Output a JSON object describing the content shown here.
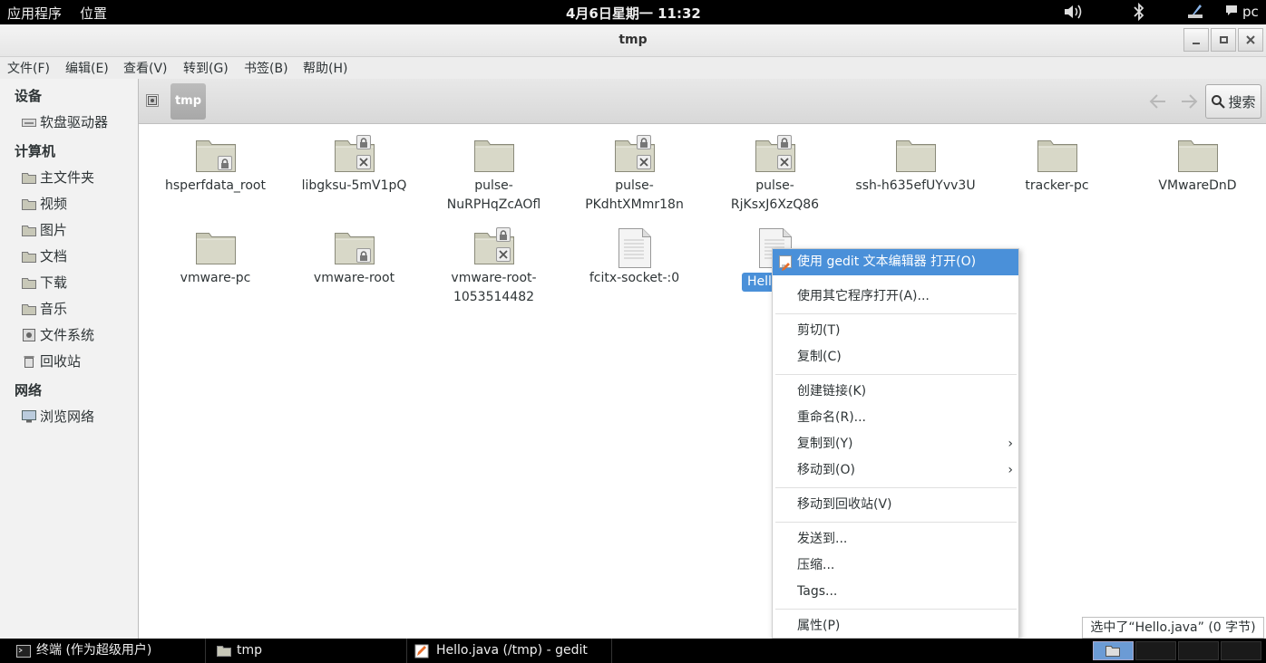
{
  "topbar": {
    "apps": "应用程序",
    "places": "位置",
    "clock": "4月6日星期一 11:32",
    "user": "pc"
  },
  "window": {
    "title": "tmp"
  },
  "menubar": [
    "文件(F)",
    "编辑(E)",
    "查看(V)",
    "转到(G)",
    "书签(B)",
    "帮助(H)"
  ],
  "sidebar": {
    "devices_header": "设备",
    "floppy": "软盘驱动器",
    "computer_header": "计算机",
    "home": "主文件夹",
    "videos": "视频",
    "pictures": "图片",
    "documents": "文档",
    "downloads": "下载",
    "music": "音乐",
    "filesystem": "文件系统",
    "trash": "回收站",
    "network_header": "网络",
    "browse_network": "浏览网络"
  },
  "toolbar": {
    "path": "tmp",
    "search": "搜索"
  },
  "files": [
    {
      "line1": "hsperfdata_root",
      "line2": ""
    },
    {
      "line1": "libgksu-5mV1pQ",
      "line2": ""
    },
    {
      "line1": "pulse-",
      "line2": "NuRPHqZcAOfl"
    },
    {
      "line1": "pulse-",
      "line2": "PKdhtXMmr18n"
    },
    {
      "line1": "pulse-",
      "line2": "RjKsxJ6XzQ86"
    },
    {
      "line1": "ssh-h635efUYvv3U",
      "line2": ""
    },
    {
      "line1": "tracker-pc",
      "line2": ""
    },
    {
      "line1": "VMwareDnD",
      "line2": ""
    },
    {
      "line1": "vmware-pc",
      "line2": ""
    },
    {
      "line1": "vmware-root",
      "line2": ""
    },
    {
      "line1": "vmware-root-",
      "line2": "1053514482"
    },
    {
      "line1": "fcitx-socket-:0",
      "line2": ""
    },
    {
      "line1": "Hell",
      "line2": ""
    }
  ],
  "context_menu": {
    "open_gedit": "使用 gedit 文本编辑器 打开(O)",
    "open_other": "使用其它程序打开(A)...",
    "cut": "剪切(T)",
    "copy": "复制(C)",
    "make_link": "创建链接(K)",
    "rename": "重命名(R)...",
    "copy_to": "复制到(Y)",
    "move_to": "移动到(O)",
    "move_trash": "移动到回收站(V)",
    "send_to": "发送到...",
    "compress": "压缩...",
    "tags": "Tags...",
    "properties": "属性(P)"
  },
  "status": "选中了“Hello.java” (0 字节)",
  "taskbar": {
    "terminal": "终端 (作为超级用户)",
    "tmp": "tmp",
    "gedit": "Hello.java (/tmp) - gedit"
  }
}
